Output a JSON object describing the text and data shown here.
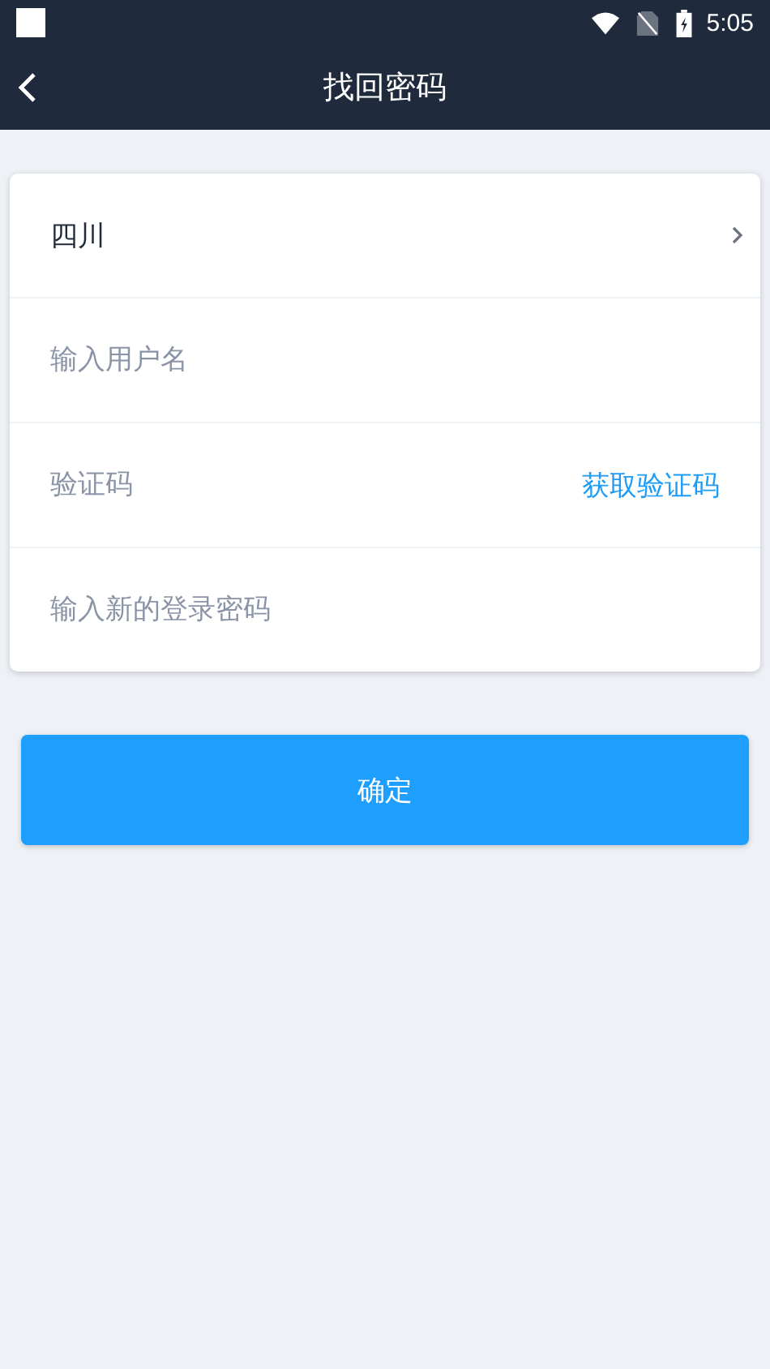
{
  "status_bar": {
    "time": "5:05"
  },
  "nav": {
    "title": "找回密码"
  },
  "form": {
    "rows": [
      {
        "kind": "select",
        "value": "四川"
      },
      {
        "kind": "input",
        "placeholder": "输入用户名"
      },
      {
        "kind": "code",
        "placeholder": "验证码",
        "action": "获取验证码"
      },
      {
        "kind": "input",
        "placeholder": "输入新的登录密码"
      }
    ]
  },
  "submit": {
    "label": "确定"
  }
}
